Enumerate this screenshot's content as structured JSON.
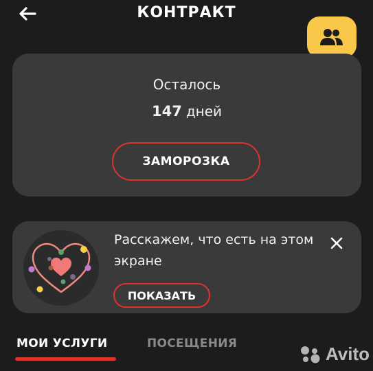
{
  "header": {
    "title": "КОНТРАКТ",
    "back_icon": "arrow-left-icon"
  },
  "float_button": {
    "icon": "people-icon",
    "close_icon": "close-icon",
    "color": "#f9c84a"
  },
  "contract": {
    "remaining_label": "Осталось",
    "remaining_days": "147",
    "days_unit": "дней",
    "freeze_label": "ЗАМОРОЗКА"
  },
  "tip": {
    "text": "Расскажем, что есть на этом экране",
    "show_label": "ПОКАЗАТЬ",
    "close_icon": "close-icon",
    "illustration": "heart-icon"
  },
  "tabs": [
    {
      "label": "МОИ УСЛУГИ",
      "active": true
    },
    {
      "label": "ПОСЕЩЕНИЯ",
      "active": false
    }
  ],
  "watermark": {
    "text": "Avito"
  },
  "colors": {
    "background": "#1c1c1c",
    "card": "#3a3a3a",
    "accent": "#e0332c",
    "yellow": "#f9c84a"
  }
}
